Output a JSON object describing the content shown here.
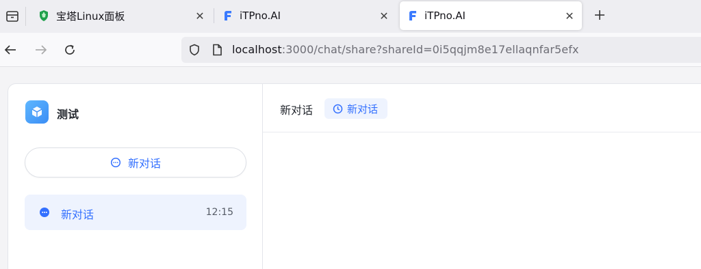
{
  "tabs": [
    {
      "title": "宝塔Linux面板",
      "icon": "baota-shield-icon",
      "active": false
    },
    {
      "title": "iTPno.AI",
      "icon": "itpno-logo-icon",
      "active": false
    },
    {
      "title": "iTPno.AI",
      "icon": "itpno-logo-icon",
      "active": true
    }
  ],
  "urlbar": {
    "host": "localhost",
    "rest": ":3000/chat/share?shareId=0i5qqjm8e17ellaqnfar5efx"
  },
  "sidebar": {
    "app_name": "测试",
    "new_chat_label": "新对话",
    "history": [
      {
        "title": "新对话",
        "time": "12:15"
      }
    ]
  },
  "chat": {
    "title": "新对话",
    "tag_label": "新对话"
  },
  "colors": {
    "accent": "#3370ff",
    "history_active_bg": "#eef3fe",
    "baota_green": "#1fa14b"
  }
}
